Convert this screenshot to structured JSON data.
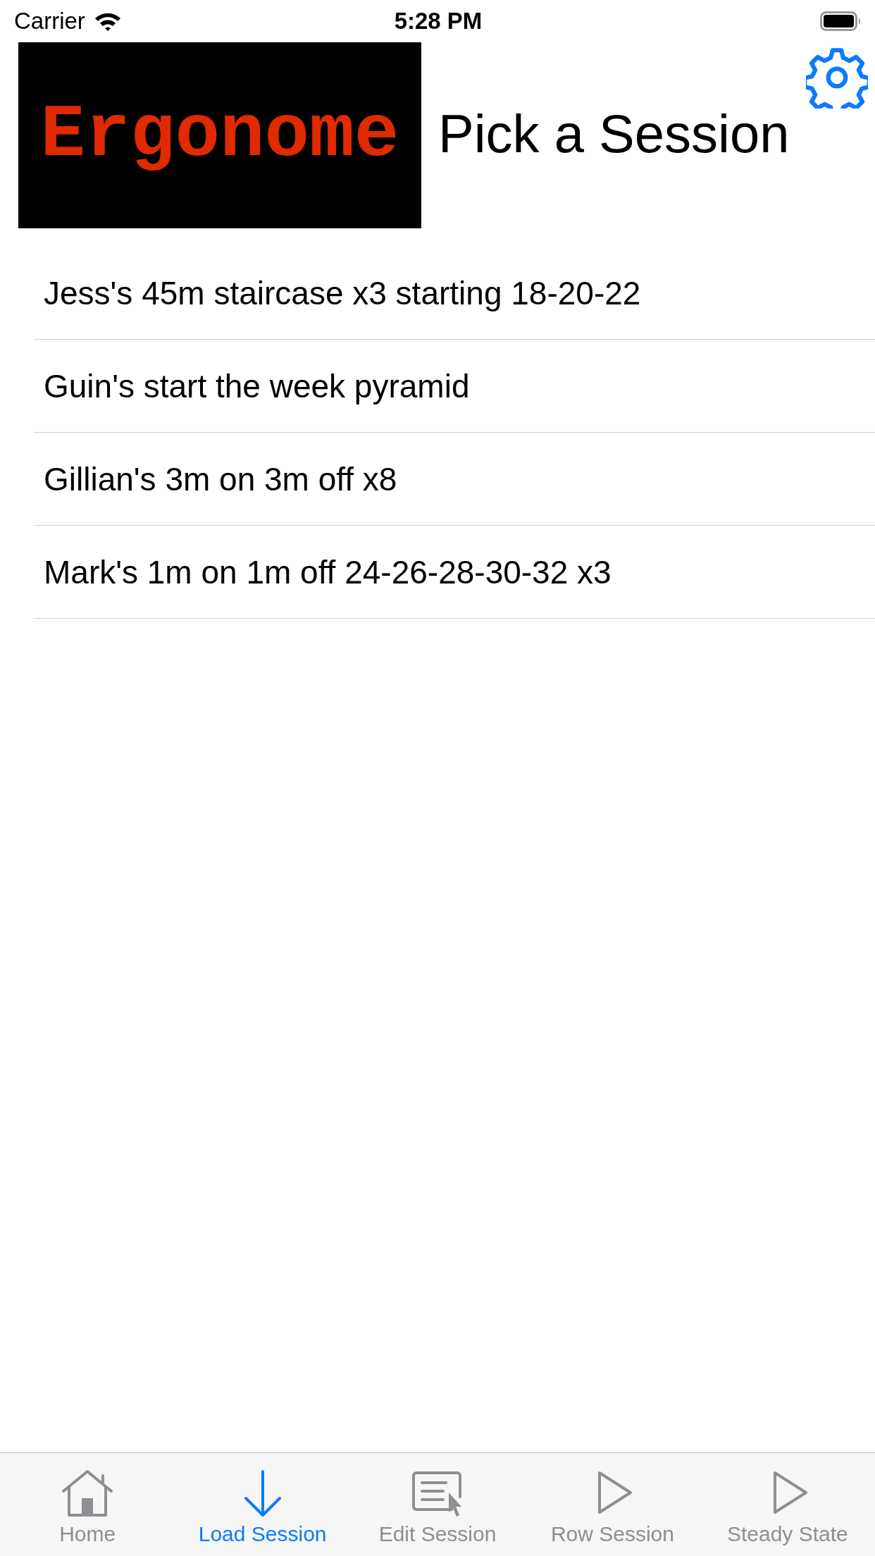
{
  "status_bar": {
    "carrier": "Carrier",
    "time": "5:28 PM"
  },
  "header": {
    "logo": "Ergonome",
    "title": "Pick a Session"
  },
  "sessions": [
    {
      "name": "Jess's 45m staircase x3 starting 18-20-22"
    },
    {
      "name": "Guin's start the week pyramid"
    },
    {
      "name": "Gillian's 3m on 3m off x8"
    },
    {
      "name": "Mark's 1m on 1m off 24-26-28-30-32 x3"
    }
  ],
  "tabs": [
    {
      "label": "Home",
      "kind": "home",
      "selected": false
    },
    {
      "label": "Load Session",
      "kind": "load",
      "selected": true
    },
    {
      "label": "Edit Session",
      "kind": "edit",
      "selected": false
    },
    {
      "label": "Row Session",
      "kind": "play",
      "selected": false
    },
    {
      "label": "Steady State",
      "kind": "play",
      "selected": false
    }
  ]
}
